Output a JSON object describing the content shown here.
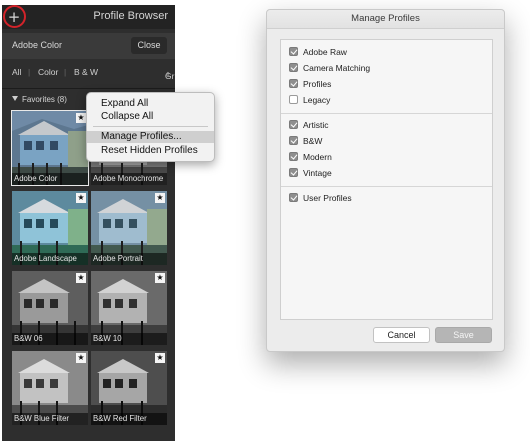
{
  "browser": {
    "title": "Profile Browser",
    "add_icon": "+",
    "group_label": "Adobe Color",
    "close_label": "Close",
    "filters": [
      "All",
      "Color",
      "B & W"
    ],
    "view_label": "Grid",
    "favorites_label": "Favorites (8)",
    "thumbnails": [
      {
        "label": "Adobe Color",
        "star": "★"
      },
      {
        "label": "Adobe Monochrome",
        "star": "★"
      },
      {
        "label": "Adobe Landscape",
        "star": "★"
      },
      {
        "label": "Adobe Portrait",
        "star": "★"
      },
      {
        "label": "B&W 06",
        "star": "★"
      },
      {
        "label": "B&W 10",
        "star": "★"
      },
      {
        "label": "B&W Blue Filter",
        "star": "★"
      },
      {
        "label": "B&W Red Filter",
        "star": "★"
      }
    ]
  },
  "context_menu": {
    "items": [
      "Expand All",
      "Collapse All",
      "Manage Profiles...",
      "Reset Hidden Profiles"
    ],
    "highlighted": "Manage Profiles..."
  },
  "dialog": {
    "title": "Manage Profiles",
    "groups": [
      [
        {
          "label": "Adobe Raw",
          "checked": true
        },
        {
          "label": "Camera Matching",
          "checked": true
        },
        {
          "label": "Profiles",
          "checked": true
        },
        {
          "label": "Legacy",
          "checked": false
        }
      ],
      [
        {
          "label": "Artistic",
          "checked": true
        },
        {
          "label": "B&W",
          "checked": true
        },
        {
          "label": "Modern",
          "checked": true
        },
        {
          "label": "Vintage",
          "checked": true
        }
      ],
      [
        {
          "label": "User Profiles",
          "checked": true
        }
      ]
    ],
    "cancel_label": "Cancel",
    "save_label": "Save"
  },
  "colors": {
    "highlight_ring": "#d2232a",
    "panel_bg": "#2e2e2e",
    "dialog_bg": "#ececec"
  }
}
